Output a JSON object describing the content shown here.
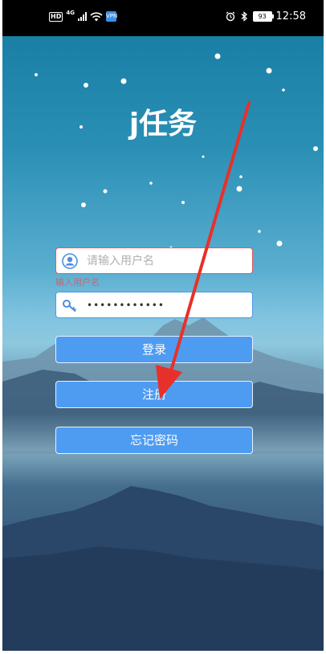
{
  "status_bar": {
    "hd": "HD",
    "network": "4G",
    "vpn": "VPN",
    "battery": "93",
    "time": "12:58"
  },
  "app": {
    "title": "j任务"
  },
  "form": {
    "username_placeholder": "请输入用户名",
    "username_value": "",
    "username_error": "输入用户名",
    "password_value": "••••••••••••",
    "login_label": "登录",
    "register_label": "注册",
    "forgot_label": "忘记密码"
  },
  "annotation": {
    "arrow_color": "#e8302a"
  }
}
